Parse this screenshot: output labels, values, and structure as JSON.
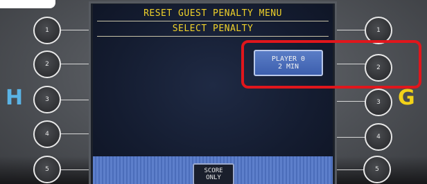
{
  "screen": {
    "title": "RESET GUEST PENALTY MENU",
    "subtitle": "SELECT PENALTY"
  },
  "player_button": {
    "line1": "PLAYER 0",
    "line2": "2 MIN"
  },
  "score_button": {
    "line1": "SCORE",
    "line2": "ONLY"
  },
  "left_buttons": [
    "1",
    "2",
    "3",
    "4",
    "5"
  ],
  "right_buttons": [
    "1",
    "2",
    "3",
    "4",
    "5"
  ],
  "side_labels": {
    "left": "H",
    "right": "G"
  },
  "colors": {
    "title_text": "#f0d22a",
    "home_letter": "#5ab4e6",
    "guest_letter": "#f2d218",
    "highlight": "#e0161c",
    "button_blue": "#4b6dba"
  }
}
